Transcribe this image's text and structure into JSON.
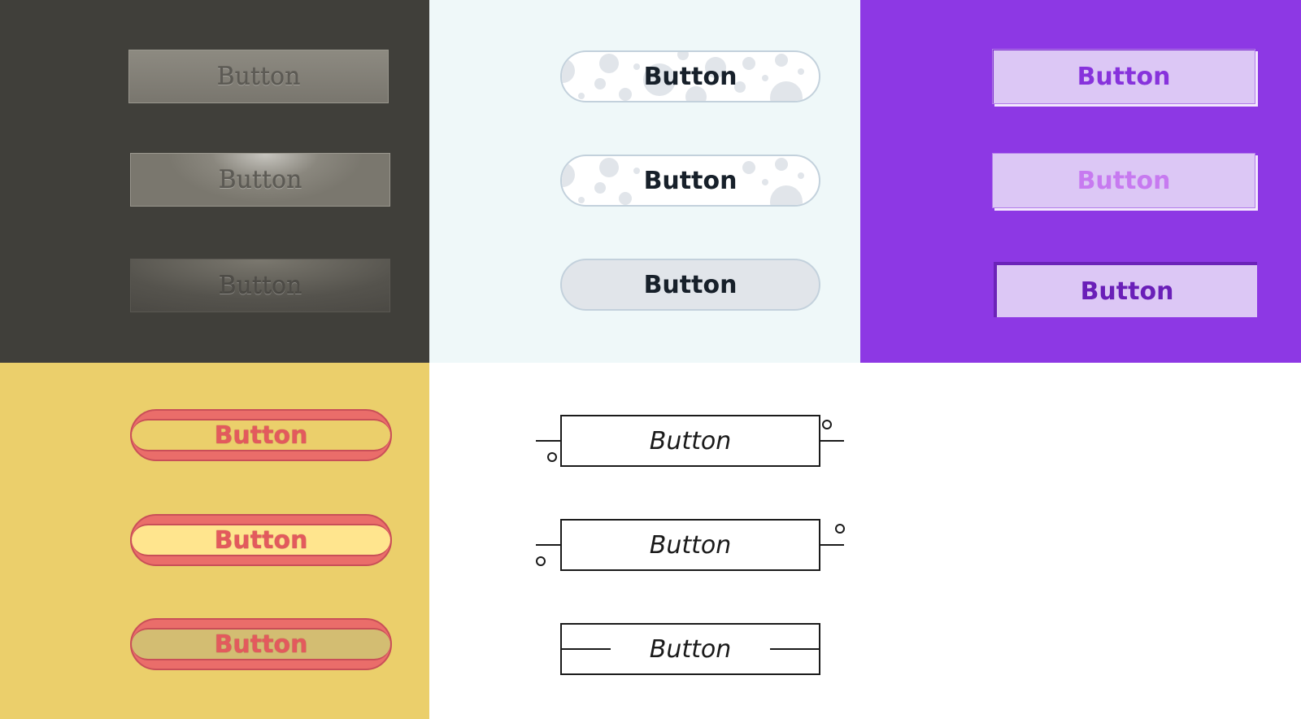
{
  "panels": {
    "metal": {
      "background": "#403f3a",
      "buttons": [
        {
          "label": "Button",
          "state": "default"
        },
        {
          "label": "Button",
          "state": "hover"
        },
        {
          "label": "Button",
          "state": "active"
        }
      ]
    },
    "bubbles": {
      "background": "#eff8f9",
      "buttons": [
        {
          "label": "Button",
          "state": "default"
        },
        {
          "label": "Button",
          "state": "hover"
        },
        {
          "label": "Button",
          "state": "active"
        }
      ]
    },
    "purple": {
      "background": "#8d38e4",
      "buttons": [
        {
          "label": "Button",
          "state": "default"
        },
        {
          "label": "Button",
          "state": "hover"
        },
        {
          "label": "Button",
          "state": "active"
        }
      ]
    },
    "hotdog": {
      "background": "#ebcf6b",
      "buttons": [
        {
          "label": "Button",
          "state": "default"
        },
        {
          "label": "Button",
          "state": "hover"
        },
        {
          "label": "Button",
          "state": "active"
        }
      ]
    },
    "schematic": {
      "background": "#ffffff",
      "buttons": [
        {
          "label": "Button",
          "state": "default"
        },
        {
          "label": "Button",
          "state": "hover"
        },
        {
          "label": "Button",
          "state": "active"
        }
      ]
    }
  }
}
